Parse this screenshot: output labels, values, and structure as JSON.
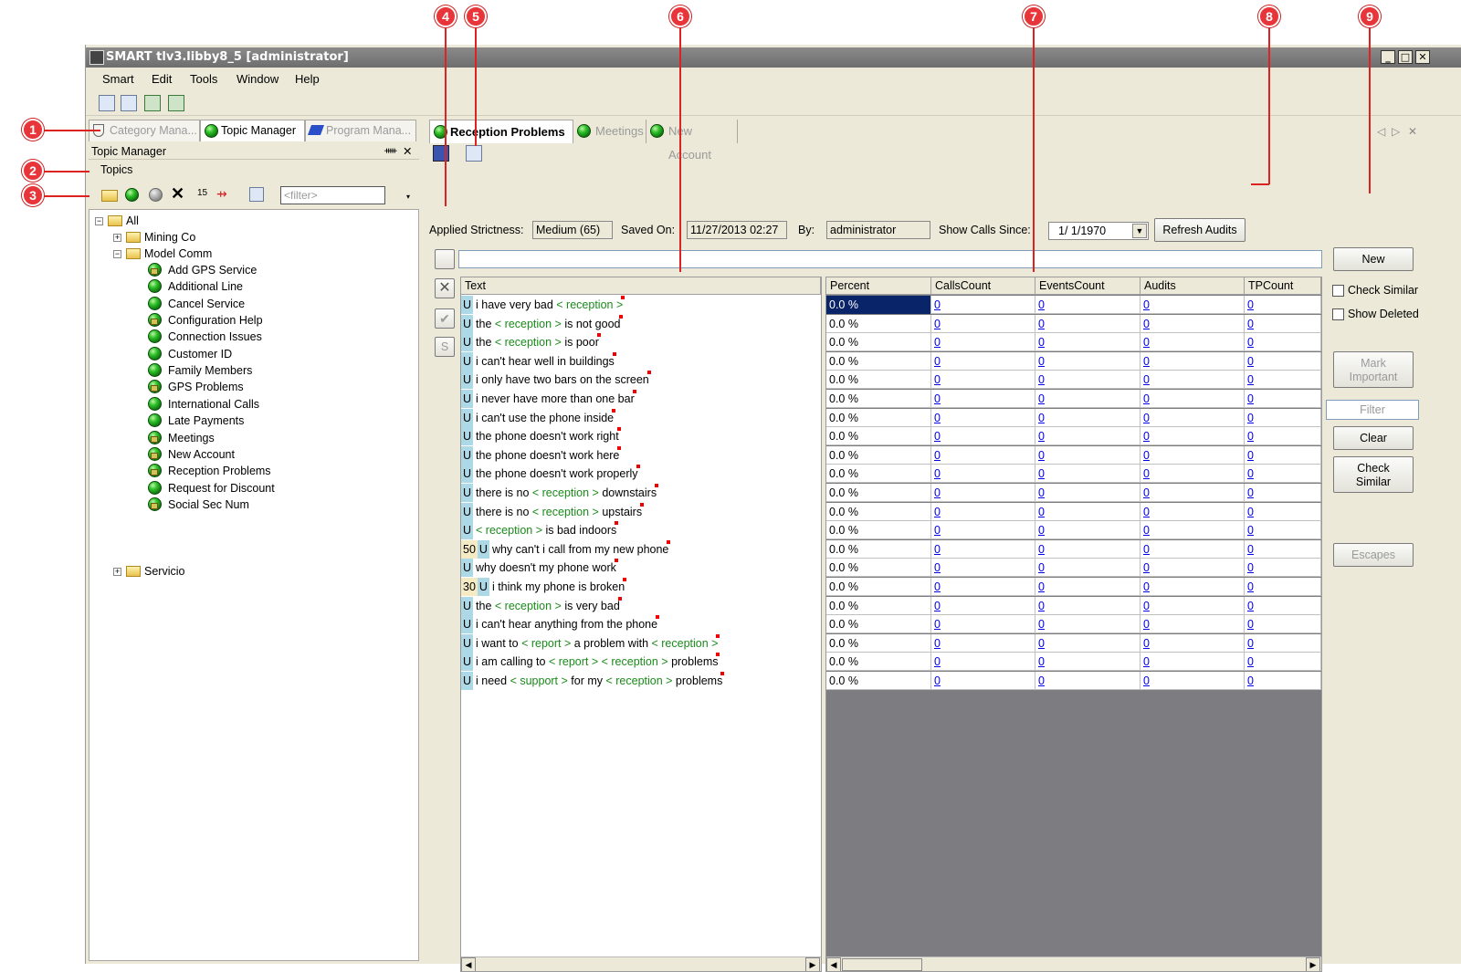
{
  "window": {
    "title": "SMART tlv3.libby8_5 [administrator]",
    "minimize": "_",
    "maximize": "□",
    "close": "✕"
  },
  "menu": [
    "Smart",
    "Edit",
    "Tools",
    "Window",
    "Help"
  ],
  "callouts": [
    "1",
    "2",
    "3",
    "4",
    "5",
    "6",
    "7",
    "8",
    "9"
  ],
  "left_tabs": [
    "Category Mana...",
    "Topic Manager",
    "Program Mana..."
  ],
  "panel": {
    "title": "Topic Manager",
    "pin": "📌",
    "close": "✕",
    "topics_label": "Topics",
    "count": "15",
    "filter_placeholder": "<filter>"
  },
  "tree": {
    "root": "All",
    "folders": [
      "Mining Co",
      "Model Comm",
      "Servicio"
    ],
    "topics": [
      {
        "label": "Add GPS Service",
        "icon": "lock-bulb"
      },
      {
        "label": "Additional Line",
        "icon": "bulb"
      },
      {
        "label": "Cancel Service",
        "icon": "bulb"
      },
      {
        "label": "Configuration Help",
        "icon": "lock-bulb"
      },
      {
        "label": "Connection Issues",
        "icon": "bulb"
      },
      {
        "label": "Customer ID",
        "icon": "bulb"
      },
      {
        "label": "Family Members",
        "icon": "bulb"
      },
      {
        "label": "GPS Problems",
        "icon": "lock-bulb"
      },
      {
        "label": "International Calls",
        "icon": "bulb"
      },
      {
        "label": "Late Payments",
        "icon": "bulb"
      },
      {
        "label": "Meetings",
        "icon": "lock-bulb"
      },
      {
        "label": "New Account",
        "icon": "lock-bulb"
      },
      {
        "label": "Reception Problems",
        "icon": "lock-bulb"
      },
      {
        "label": "Request for Discount",
        "icon": "bulb"
      },
      {
        "label": "Social Sec Num",
        "icon": "lock-bulb"
      }
    ]
  },
  "right_tabs": [
    "Reception Problems",
    "Meetings",
    "New Account"
  ],
  "tab_nav": {
    "prev": "◁",
    "next": "▷",
    "close": "✕"
  },
  "info": {
    "strictness_label": "Applied Strictness:",
    "strictness_value": "Medium (65)",
    "saved_label": "Saved On:",
    "saved_value": "11/27/2013 02:27",
    "by_label": "By:",
    "by_value": "administrator",
    "since_label": "Show Calls Since:",
    "since_value": "1/  1/1970",
    "refresh_button": "Refresh Audits"
  },
  "text_column_header": "Text",
  "side_buttons": {
    "s_label": "S"
  },
  "phrases": [
    [
      {
        "u": "U"
      },
      {
        "t": "i have very bad "
      },
      {
        "g": "< reception >"
      }
    ],
    [
      {
        "u": "U"
      },
      {
        "t": "the "
      },
      {
        "g": "< reception >"
      },
      {
        "t": " is not good"
      }
    ],
    [
      {
        "u": "U"
      },
      {
        "t": "the "
      },
      {
        "g": "< reception >"
      },
      {
        "t": " is poor"
      }
    ],
    [
      {
        "u": "U"
      },
      {
        "t": "i can't hear well in buildings"
      }
    ],
    [
      {
        "u": "U"
      },
      {
        "t": "i only have two bars on the screen"
      }
    ],
    [
      {
        "u": "U"
      },
      {
        "t": "i never have more than one bar"
      }
    ],
    [
      {
        "u": "U"
      },
      {
        "t": "i can't use the phone inside"
      }
    ],
    [
      {
        "u": "U"
      },
      {
        "t": "the phone doesn't work right"
      }
    ],
    [
      {
        "u": "U"
      },
      {
        "t": "the phone doesn't work here"
      }
    ],
    [
      {
        "u": "U"
      },
      {
        "t": "the phone doesn't work properly"
      }
    ],
    [
      {
        "u": "U"
      },
      {
        "t": "there is no "
      },
      {
        "g": "< reception >"
      },
      {
        "t": " downstairs"
      }
    ],
    [
      {
        "u": "U"
      },
      {
        "t": "there is no "
      },
      {
        "g": "< reception >"
      },
      {
        "t": " upstairs"
      }
    ],
    [
      {
        "u": "U"
      },
      {
        "g": "< reception >"
      },
      {
        "t": " is bad indoors"
      }
    ],
    [
      {
        "n": "50"
      },
      {
        "u": "U"
      },
      {
        "t": "why can't i call from my new phone"
      }
    ],
    [
      {
        "u": "U"
      },
      {
        "t": "why doesn't my phone work"
      }
    ],
    [
      {
        "n": "30"
      },
      {
        "u": "U"
      },
      {
        "t": "i think my phone is broken"
      }
    ],
    [
      {
        "u": "U"
      },
      {
        "t": "the "
      },
      {
        "g": "< reception >"
      },
      {
        "t": " is very bad"
      }
    ],
    [
      {
        "u": "U"
      },
      {
        "t": "i can't hear anything from the phone"
      }
    ],
    [
      {
        "u": "U"
      },
      {
        "t": "i want to "
      },
      {
        "g": "< report >"
      },
      {
        "t": " a problem with "
      },
      {
        "g": "< reception >"
      }
    ],
    [
      {
        "u": "U"
      },
      {
        "t": "i am calling to "
      },
      {
        "g": "< report >"
      },
      {
        "t": " "
      },
      {
        "g": "< reception >"
      },
      {
        "t": " problems"
      }
    ],
    [
      {
        "u": "U"
      },
      {
        "t": "i need "
      },
      {
        "g": "< support >"
      },
      {
        "t": " for my "
      },
      {
        "g": "< reception >"
      },
      {
        "t": " problems"
      }
    ]
  ],
  "stats": {
    "columns": [
      "Percent",
      "CallsCount",
      "EventsCount",
      "Audits",
      "TPCount"
    ],
    "percent": "0.0 %",
    "count": "0"
  },
  "right_controls": {
    "new_button": "New",
    "check_similar_label": "Check Similar",
    "show_deleted_label": "Show Deleted",
    "mark_important_button": "Mark Important",
    "filter_placeholder": "Filter",
    "clear_button": "Clear",
    "check_similar_button": "Check Similar",
    "escapes_button": "Escapes"
  },
  "scroll": {
    "left": "◀",
    "right": "▶"
  }
}
